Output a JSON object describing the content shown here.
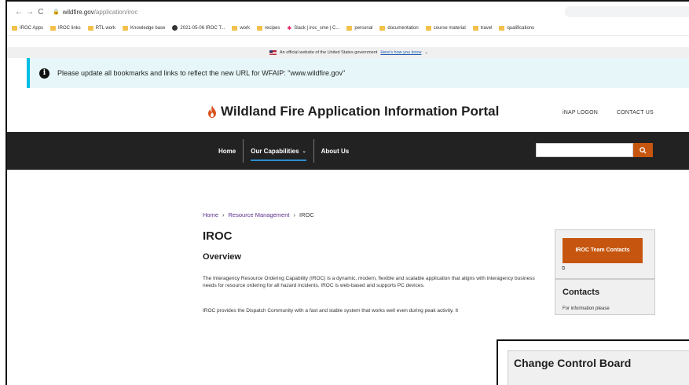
{
  "browser": {
    "url_host": "wildfire.gov",
    "url_path": "/application/iroc",
    "bookmarks": [
      "IROC Apps",
      "IROC links",
      "RTL work",
      "Knowledge base",
      "2021-05-06 IROC T...",
      "work",
      "recipes",
      "Slack | iroc_sme | C...",
      "personal",
      "documentation",
      "course material",
      "travel",
      "qualifications"
    ]
  },
  "gov_banner": {
    "text": "An official website of the United States government",
    "link": "Here's how you know"
  },
  "alert": {
    "message": "Please update all bookmarks and links to reflect the new URL for WFAIP: \"www.wildfire.gov\""
  },
  "header": {
    "title": "Wildland Fire Application Information Portal",
    "links": [
      "iNAP LOGON",
      "CONTACT US"
    ]
  },
  "nav": {
    "items": [
      "Home",
      "Our Capabilities",
      "About Us"
    ],
    "search_placeholder": ""
  },
  "breadcrumb": [
    "Home",
    "Resource Management",
    "IROC"
  ],
  "page": {
    "title": "IROC",
    "section": "Overview",
    "para1": "The Interagency Resource Ordering Capability (IROC) is a dynamic, modern, flexible and scalable application that aligns with interagency business needs for resource ordering for all hazard incidents. IROC is web-based and supports PC devices.",
    "para2": "IROC provides the Dispatch Community with a fast and stable system that works well even during peak activity. It"
  },
  "sidebar": {
    "team_button": "IROC Team Contacts",
    "contacts_title": "Contacts",
    "contacts_text": "For information please"
  },
  "inset": {
    "title": "Change Control Board"
  },
  "colors": {
    "accent": "#c6560f",
    "nav_bg": "#222222",
    "alert_bg": "#e7f6f8",
    "alert_border": "#00bde3"
  }
}
